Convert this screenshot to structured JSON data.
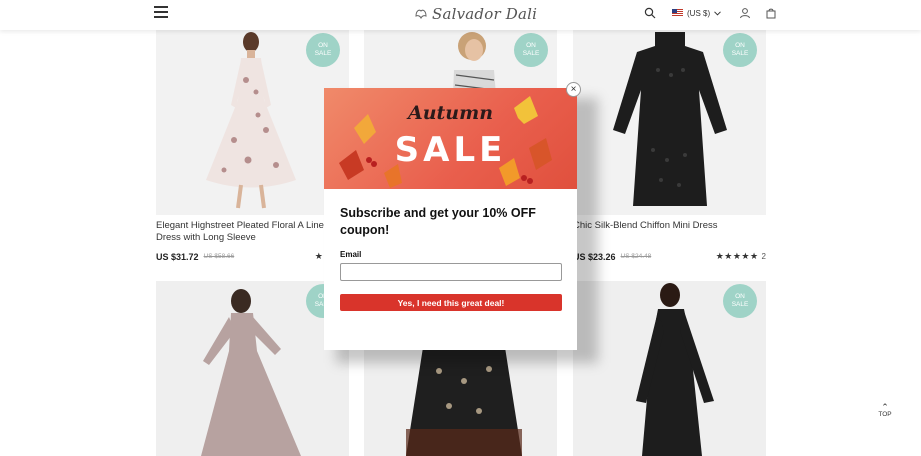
{
  "header": {
    "brand": "Salvador Dali",
    "currency": "(US $)",
    "icons": [
      "menu-icon",
      "search-icon",
      "chevron-down-icon",
      "user-icon",
      "shopping-bag-icon"
    ]
  },
  "badge": {
    "line1": "ON",
    "line2": "SALE"
  },
  "products": [
    {
      "name": "Elegant Highstreet Pleated Floral A Line Dress with Long Sleeve",
      "price": "US $31.72",
      "old_price": "US $58.66",
      "stars": "★★★★",
      "rating_count": ""
    },
    {
      "name": "",
      "price": "",
      "old_price": "",
      "stars": "",
      "rating_count": ""
    },
    {
      "name": "Chic Silk-Blend Chiffon Mini Dress",
      "price": "US $23.26",
      "old_price": "US $24.48",
      "stars": "★★★★★",
      "rating_count": "2"
    }
  ],
  "popup": {
    "banner_script": "Autumn",
    "banner_title": "SALE",
    "close": "×",
    "title": "Subscribe and get your 10% OFF coupon!",
    "email_label": "Email",
    "email_value": "",
    "email_placeholder": "",
    "cta": "Yes, I need this great deal!"
  },
  "back_to_top": "TOP",
  "colors": {
    "badge": "#9fd3c7",
    "cta": "#d9342b",
    "banner": "#e95f4d"
  }
}
